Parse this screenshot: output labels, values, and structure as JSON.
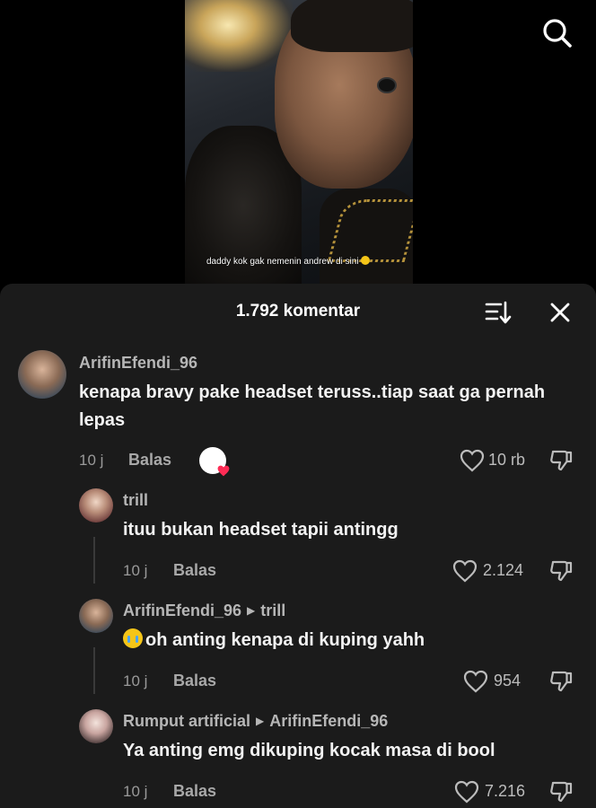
{
  "video": {
    "caption": "daddy kok gak nemenin andrew di sini"
  },
  "icons": {
    "search": "search-icon",
    "sort": "sort-icon",
    "close": "close-icon",
    "heart": "heart-icon",
    "dislike": "dislike-icon"
  },
  "colors": {
    "sheet_bg": "#1b1b1b",
    "text_primary": "#f2f2f2",
    "text_secondary": "#9a9a9a"
  },
  "sheet": {
    "title": "1.792 komentar"
  },
  "comments": [
    {
      "username": "ArifinEfendi_96",
      "reply_to": "",
      "text": "kenapa bravy pake headset teruss..tiap saat ga pernah lepas",
      "time": "10 j",
      "reply_label": "Balas",
      "likes": "10 rb",
      "creator_liked": true
    },
    {
      "username": "trill",
      "reply_to": "",
      "text": "ituu bukan headset tapii antingg",
      "time": "10 j",
      "reply_label": "Balas",
      "likes": "2.124"
    },
    {
      "username": "ArifinEfendi_96",
      "reply_to": "trill",
      "text": "oh anting kenapa di kuping yahh",
      "time": "10 j",
      "reply_label": "Balas",
      "likes": "954"
    },
    {
      "username": "Rumput artificial",
      "reply_to": "ArifinEfendi_96",
      "text": "Ya anting emg dikuping kocak masa di bool",
      "time": "10 j",
      "reply_label": "Balas",
      "likes": "7.216"
    }
  ]
}
